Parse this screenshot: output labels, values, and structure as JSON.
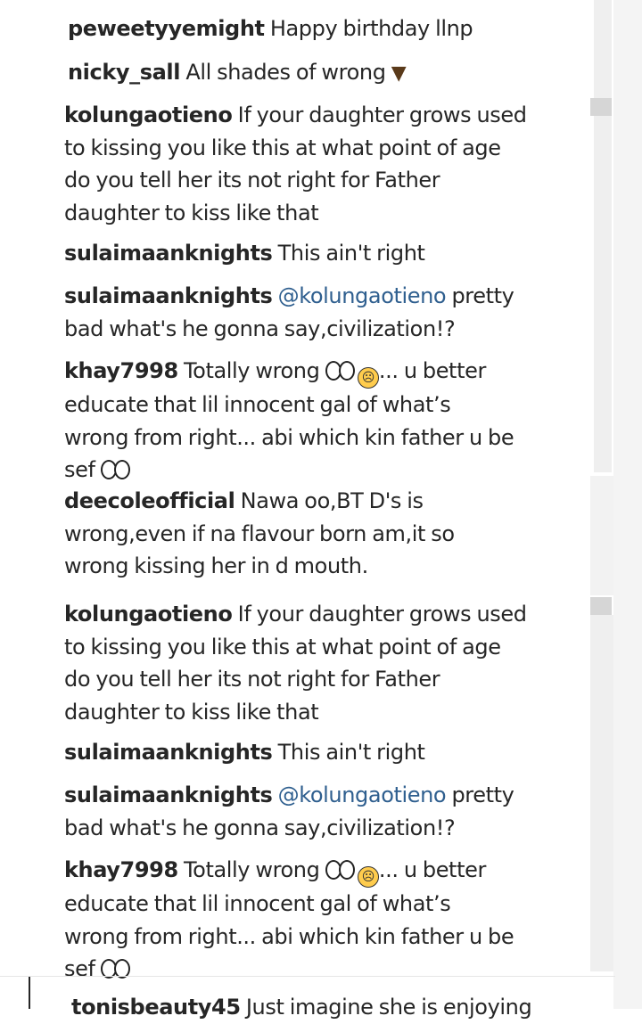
{
  "comments": [
    {
      "user": "peweetyyemight",
      "text": "Happy birthday llnp",
      "lines": []
    },
    {
      "user": "nicky_sall",
      "text": "All shades of wrong",
      "emoji": "thumbs-down"
    },
    {
      "user": "kolungaotieno",
      "lines": [
        "If your daughter grows used",
        "to kissing you like this at what point of age",
        "do you tell her its not right for Father",
        "daughter to kiss like that"
      ]
    },
    {
      "user": "sulaimaanknights",
      "text": "This ain't right"
    },
    {
      "user": "sulaimaanknights",
      "mention": "@kolungaotieno",
      "lines": [
        "pretty",
        "bad what's he gonna say,civilization!?"
      ]
    },
    {
      "user": "khay7998",
      "lines": [
        "Totally wrong",
        "... u better",
        "educate that lil innocent gal of what’s",
        "wrong from right... abi which kin father u be",
        "sef"
      ]
    },
    {
      "user": "deecoleofficial",
      "lines": [
        "Nawa oo,BT D's is",
        "wrong,even if na flavour born am,it so",
        "wrong kissing her in d mouth."
      ]
    },
    {
      "user": "kolungaotieno",
      "lines": [
        "If your daughter grows used",
        "to kissing you like this at what point of age",
        "do you tell her its not right for Father",
        "daughter to kiss like that"
      ]
    },
    {
      "user": "sulaimaanknights",
      "text": "This ain't right"
    },
    {
      "user": "sulaimaanknights",
      "mention": "@kolungaotieno",
      "lines": [
        "pretty",
        "bad what's he gonna say,civilization!?"
      ]
    },
    {
      "user": "khay7998",
      "lines": [
        "Totally wrong",
        "... u better",
        "educate that lil innocent gal of what’s",
        "wrong from right... abi which kin father u be",
        "sef"
      ]
    },
    {
      "user": "tonisbeauty45",
      "text": "Just imagine she is enjoying"
    }
  ]
}
